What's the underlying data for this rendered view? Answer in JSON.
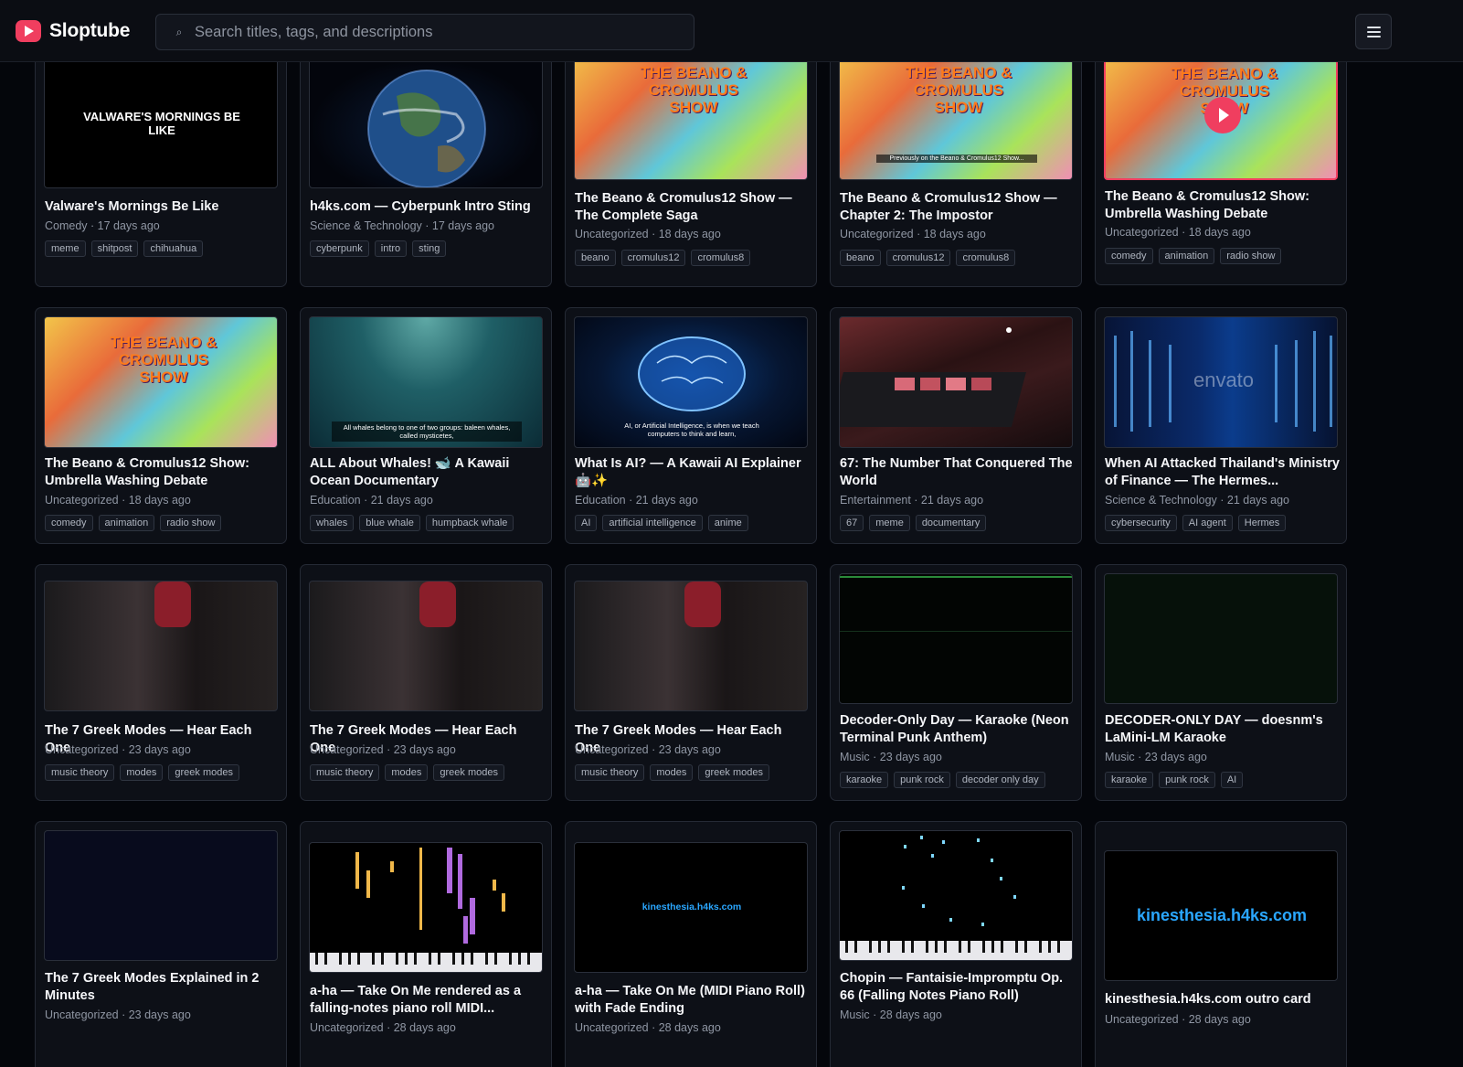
{
  "app": {
    "name": "Sloptube"
  },
  "search": {
    "placeholder": "Search titles, tags, and descriptions"
  },
  "colors": {
    "accent": "#f03e5f",
    "background": "#04060b",
    "card": "#0d1017",
    "link_cyan": "#2aa7ff"
  },
  "videos": [
    {
      "title": "Valware's Mornings Be Like",
      "meta": "Comedy · 17 days ago",
      "tags": [
        "meme",
        "shitpost",
        "chihuahua"
      ],
      "thumb_text": "VALWARE'S MORNINGS BE LIKE"
    },
    {
      "title": "h4ks.com — Cyberpunk Intro Sting",
      "meta": "Science & Technology · 17 days ago",
      "tags": [
        "cyberpunk",
        "intro",
        "sting"
      ]
    },
    {
      "title": "The Beano & Cromulus12 Show — The Complete Saga",
      "meta": "Uncategorized · 18 days ago",
      "tags": [
        "beano",
        "cromulus12",
        "cromulus8"
      ],
      "thumb_text": "THE BEANO & CROMULUS SHOW"
    },
    {
      "title": "The Beano & Cromulus12 Show — Chapter 2: The Impostor",
      "meta": "Uncategorized · 18 days ago",
      "tags": [
        "beano",
        "cromulus12",
        "cromulus8"
      ],
      "thumb_text": "THE BEANO & CROMULUS SHOW",
      "thumb_caption": "Previously on the Beano & Cromulus12 Show..."
    },
    {
      "title": "The Beano & Cromulus12 Show: Umbrella Washing Debate",
      "meta": "Uncategorized · 18 days ago",
      "tags": [
        "comedy",
        "animation",
        "radio show"
      ],
      "thumb_text": "THE BEANO & CROMULUS SHOW"
    },
    {
      "title": "The Beano & Cromulus12 Show: Umbrella Washing Debate",
      "meta": "Uncategorized · 18 days ago",
      "tags": [
        "comedy",
        "animation",
        "radio show"
      ],
      "thumb_text": "THE BEANO & CROMULUS SHOW"
    },
    {
      "title": "ALL About Whales! 🐋 A Kawaii Ocean Documentary",
      "meta": "Education · 21 days ago",
      "tags": [
        "whales",
        "blue whale",
        "humpback whale"
      ],
      "thumb_caption": "All whales belong to one of two groups: baleen whales, called mysticetes,"
    },
    {
      "title": "What Is AI? — A Kawaii AI Explainer 🤖✨",
      "meta": "Education · 21 days ago",
      "tags": [
        "AI",
        "artificial intelligence",
        "anime"
      ],
      "thumb_caption": "AI, or Artificial Intelligence, is when we teach computers to think and learn,"
    },
    {
      "title": "67: The Number That Conquered The World",
      "meta": "Entertainment · 21 days ago",
      "tags": [
        "67",
        "meme",
        "documentary"
      ]
    },
    {
      "title": "When AI Attacked Thailand's Ministry of Finance — The Hermes...",
      "meta": "Science & Technology · 21 days ago",
      "tags": [
        "cybersecurity",
        "AI agent",
        "Hermes"
      ],
      "thumb_text": "envato"
    },
    {
      "title": "The 7 Greek Modes — Hear Each One",
      "meta": "Uncategorized · 23 days ago",
      "tags": [
        "music theory",
        "modes",
        "greek modes"
      ]
    },
    {
      "title": "The 7 Greek Modes — Hear Each One",
      "meta": "Uncategorized · 23 days ago",
      "tags": [
        "music theory",
        "modes",
        "greek modes"
      ]
    },
    {
      "title": "The 7 Greek Modes — Hear Each One",
      "meta": "Uncategorized · 23 days ago",
      "tags": [
        "music theory",
        "modes",
        "greek modes"
      ]
    },
    {
      "title": "Decoder-Only Day — Karaoke (Neon Terminal Punk Anthem)",
      "meta": "Music · 23 days ago",
      "tags": [
        "karaoke",
        "punk rock",
        "decoder only day"
      ]
    },
    {
      "title": "DECODER-ONLY DAY — doesnm's LaMini-LM Karaoke",
      "meta": "Music · 23 days ago",
      "tags": [
        "karaoke",
        "punk rock",
        "AI"
      ]
    },
    {
      "title": "The 7 Greek Modes Explained in 2 Minutes",
      "meta": "Uncategorized · 23 days ago",
      "tags": []
    },
    {
      "title": "a-ha — Take On Me rendered as a falling-notes piano roll MIDI...",
      "meta": "Uncategorized · 28 days ago",
      "tags": []
    },
    {
      "title": "a-ha — Take On Me (MIDI Piano Roll) with Fade Ending",
      "meta": "Uncategorized · 28 days ago",
      "tags": [],
      "thumb_text": "kinesthesia.h4ks.com"
    },
    {
      "title": "Chopin — Fantaisie-Impromptu Op. 66 (Falling Notes Piano Roll)",
      "meta": "Music · 28 days ago",
      "tags": []
    },
    {
      "title": "kinesthesia.h4ks.com outro card",
      "meta": "Uncategorized · 28 days ago",
      "tags": [],
      "thumb_text": "kinesthesia.h4ks.com"
    }
  ]
}
